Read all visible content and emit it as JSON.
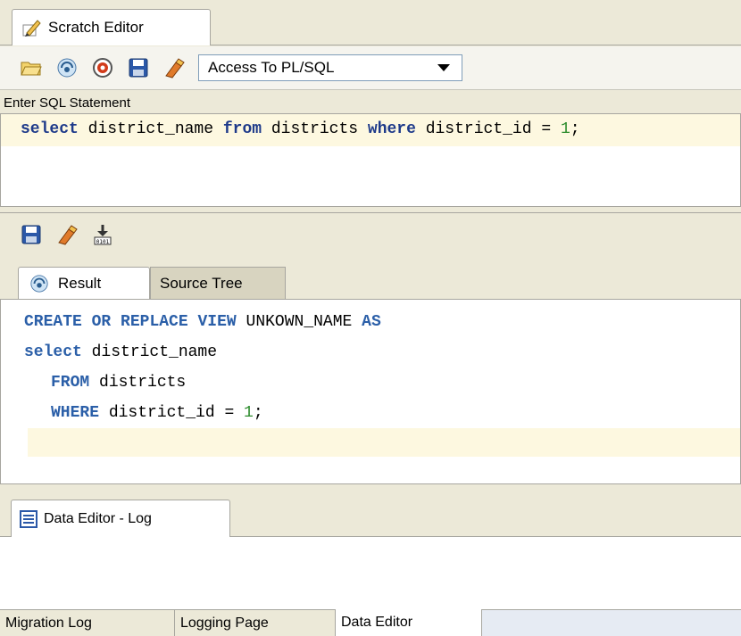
{
  "scratch_tab": {
    "label": "Scratch Editor"
  },
  "toolbar": {
    "icons": [
      "open-folder-icon",
      "connection-icon",
      "run-target-icon",
      "save-icon",
      "eraser-icon"
    ],
    "translation_select": "Access To PL/SQL"
  },
  "sql_label": "Enter SQL Statement",
  "sql": {
    "kw_select": "select",
    "t1": " district_name ",
    "kw_from": "from",
    "t2": " districts ",
    "kw_where": "where",
    "t3": " district_id = ",
    "num": "1",
    "t4": ";"
  },
  "result_toolbar": {
    "icons": [
      "save-icon",
      "eraser-icon",
      "export-binary-icon"
    ]
  },
  "result_tabs": [
    {
      "label": "Result"
    },
    {
      "label": "Source Tree"
    }
  ],
  "result_code": {
    "line1": {
      "k1": "CREATE",
      "k2": "OR",
      "k3": "REPLACE",
      "k4": "VIEW",
      "name": "UNKOWN_NAME",
      "k5": "AS"
    },
    "line2": {
      "k": "select",
      "rest": " district_name"
    },
    "line3": {
      "k": "FROM",
      "rest": " districts"
    },
    "line4": {
      "k": "WHERE",
      "rest": " district_id = ",
      "num": "1",
      "end": ";"
    }
  },
  "log_tab": {
    "label": "Data Editor - Log"
  },
  "bottom_tabs": [
    {
      "label": "Migration Log"
    },
    {
      "label": "Logging Page"
    },
    {
      "label": "Data Editor"
    }
  ],
  "colors": {
    "accent_bg": "#fdf8e0",
    "keyword": "#1e3a8a"
  }
}
